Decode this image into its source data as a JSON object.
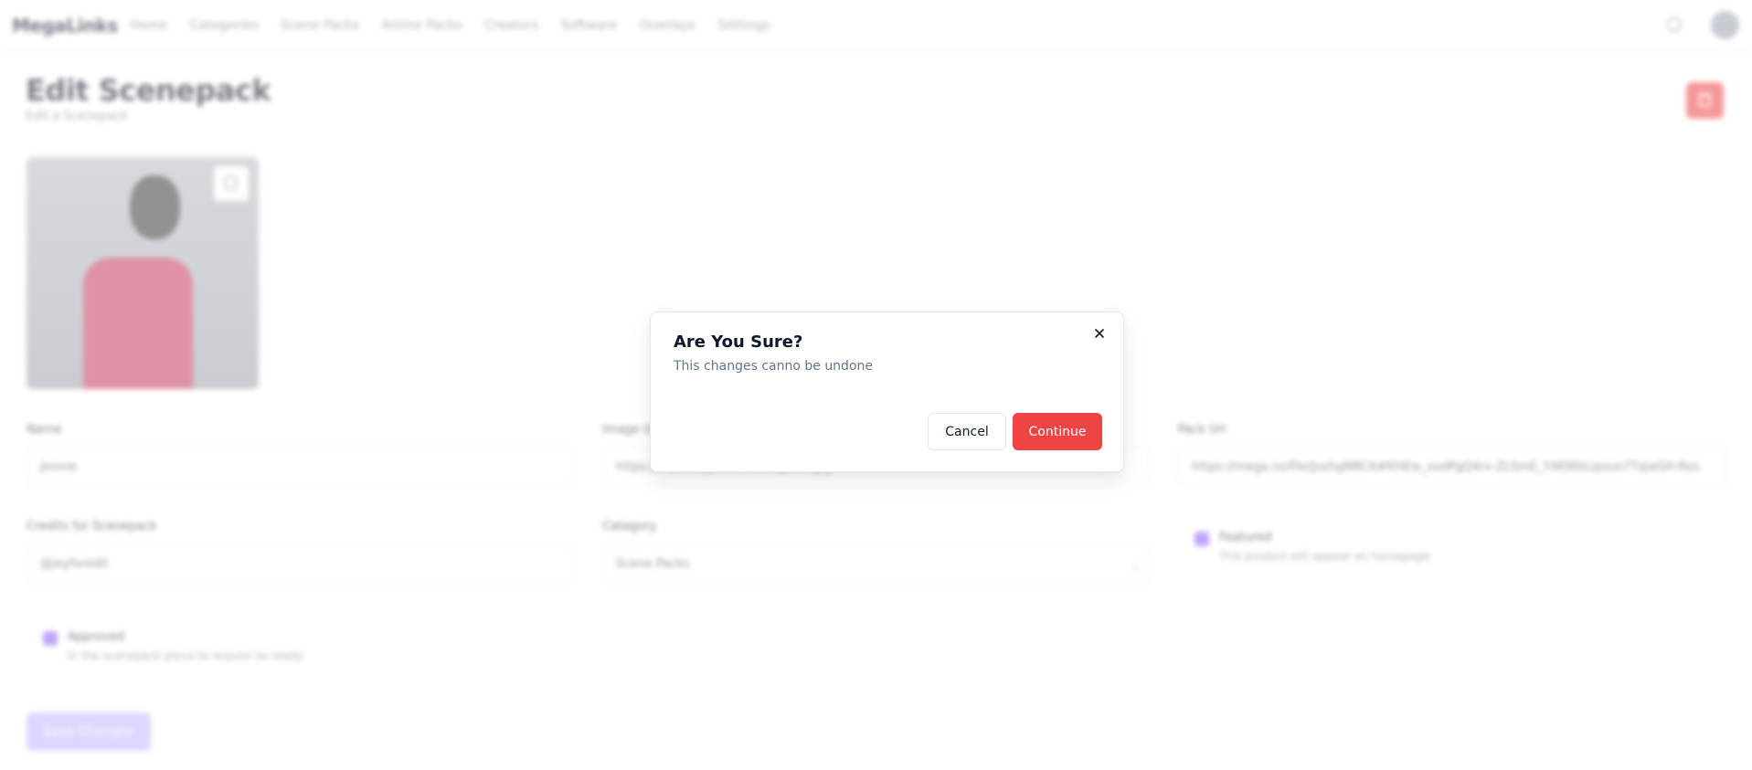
{
  "nav": {
    "logo": "MegaLinks",
    "links": [
      "Home",
      "Categories",
      "Scene Packs",
      "Anime Packs",
      "Creators",
      "Software",
      "Overlays",
      "Settings"
    ],
    "search_icon": "search-icon",
    "avatar_icon": "avatar-icon"
  },
  "page": {
    "title": "Edit Scenepack",
    "subtitle": "Edit a Scenepack"
  },
  "form": {
    "name_label": "Name",
    "name_value": "Jennie",
    "image_url_label": "Image Url",
    "image_url_value": "https://i.ibb.co/jennie-scenepack.jpg",
    "pack_url_label": "Pack Url",
    "pack_url_value": "https://mega.nz/file/JuzhgNRCA#KHEw_xodPgQ4rv-ZLSmE_Y4KWbLipsuo7TqiaGH-Ros",
    "credits_label": "Credits for Scenepack",
    "credits_value": "@jeyforedit",
    "category_label": "Category",
    "category_value": "Scene Packs",
    "featured_title": "Featured",
    "featured_desc": "This product will appear on homepage",
    "approved_title": "Approved",
    "approved_desc": "In the scenepack piece to require no ready.",
    "save_label": "Save Changes"
  },
  "modal": {
    "title": "Are You Sure?",
    "description": "This changes canno be undone",
    "cancel_label": "Cancel",
    "continue_label": "Continue",
    "close_icon": "close-icon"
  },
  "colors": {
    "danger": "#ef4444",
    "accent": "#8b5cf6",
    "accent_light": "#c4b5fd"
  }
}
